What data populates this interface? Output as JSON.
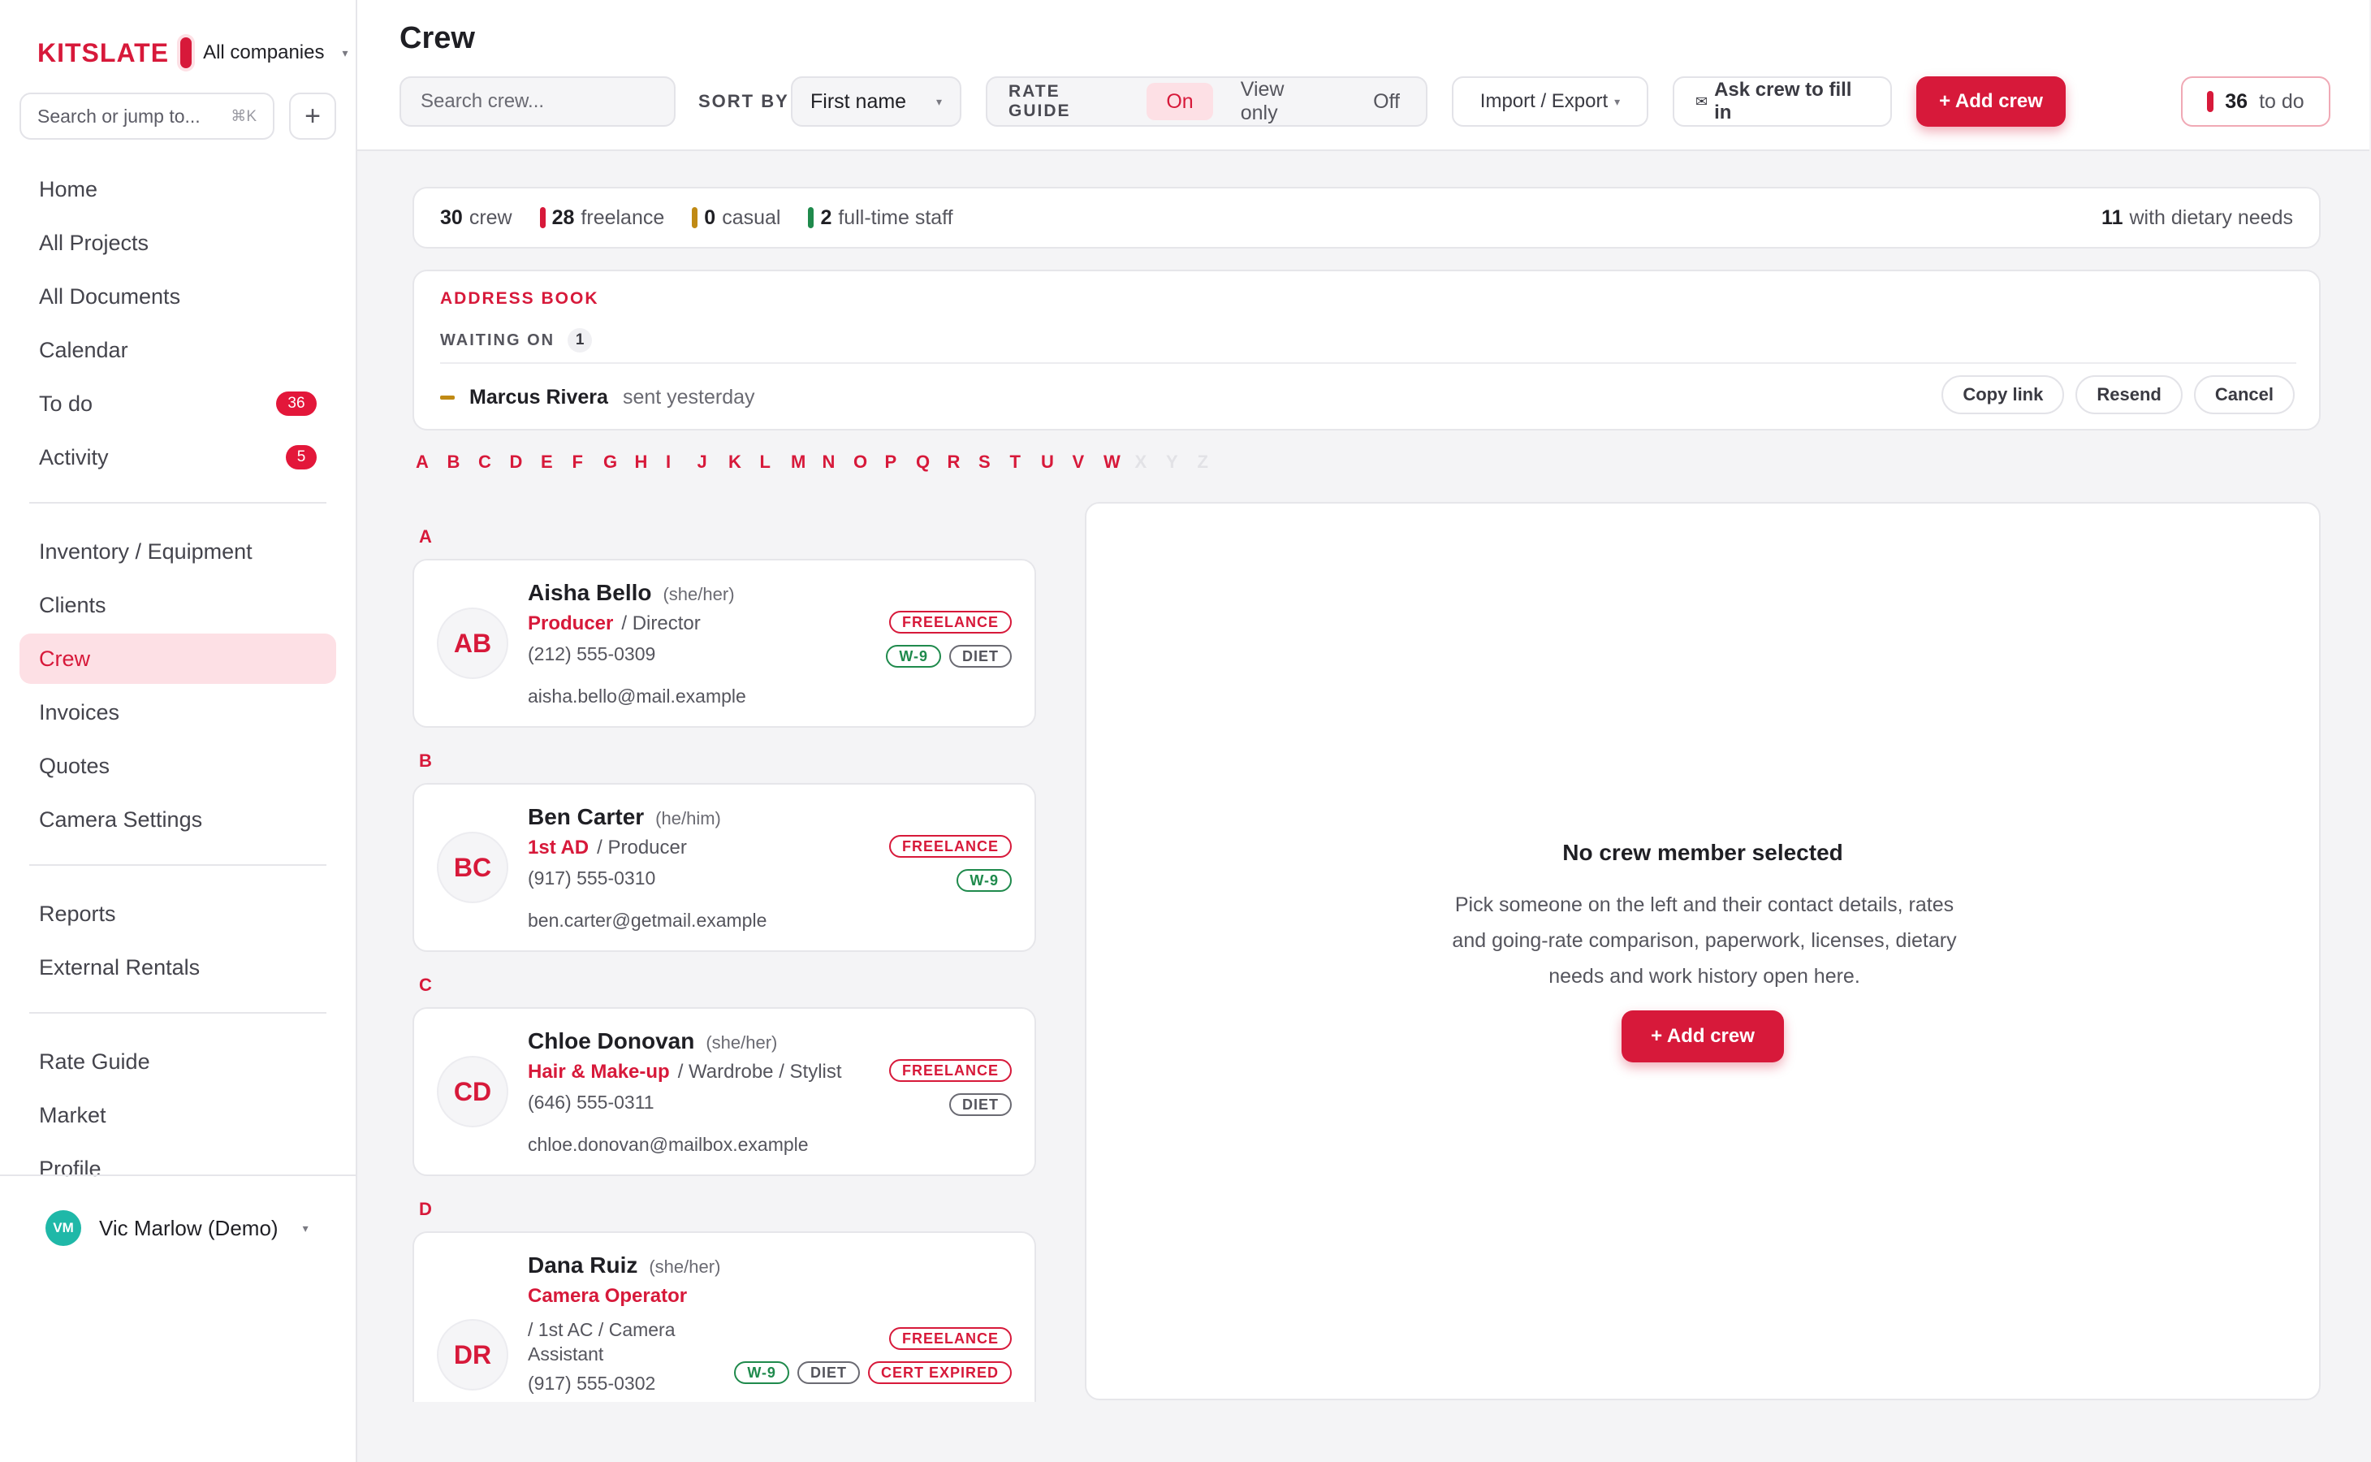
{
  "brand": {
    "name": "KITSLATE",
    "company": "All companies"
  },
  "sidebar": {
    "search_placeholder": "Search or jump to...",
    "search_kbd": "⌘K",
    "items_group1": [
      {
        "label": "Home"
      },
      {
        "label": "All Projects"
      },
      {
        "label": "All Documents"
      },
      {
        "label": "Calendar"
      },
      {
        "label": "To do",
        "badge": "36"
      },
      {
        "label": "Activity",
        "badge": "5"
      }
    ],
    "items_group2": [
      {
        "label": "Inventory / Equipment"
      },
      {
        "label": "Clients"
      },
      {
        "label": "Crew",
        "active": true
      },
      {
        "label": "Invoices"
      },
      {
        "label": "Quotes"
      },
      {
        "label": "Camera Settings"
      }
    ],
    "items_group3": [
      {
        "label": "Reports"
      },
      {
        "label": "External Rentals"
      }
    ],
    "items_group4": [
      {
        "label": "Rate Guide"
      },
      {
        "label": "Market"
      },
      {
        "label": "Profile"
      }
    ],
    "user": {
      "initials": "VM",
      "name": "Vic Marlow (Demo)"
    }
  },
  "header": {
    "title": "Crew",
    "search_placeholder": "Search crew...",
    "sort_label": "SORT BY",
    "sort_value": "First name",
    "rate_guide_label": "RATE GUIDE",
    "rate_options": [
      "On",
      "View only",
      "Off"
    ],
    "rate_selected": "On",
    "import_export": "Import / Export",
    "ask_crew": "Ask crew to fill in",
    "add_crew": "+ Add crew",
    "todo_count": "36",
    "todo_label": "to do"
  },
  "stats": {
    "crew": "30",
    "crew_label": "crew",
    "freelance": "28",
    "freelance_label": "freelance",
    "casual": "0",
    "casual_label": "casual",
    "staff": "2",
    "staff_label": "full-time staff",
    "dietary": "11",
    "dietary_label": "with dietary needs",
    "colors": {
      "freelance": "#d7193a",
      "casual": "#c08a14",
      "staff": "#1f8a4c"
    }
  },
  "address_book": {
    "title": "ADDRESS BOOK",
    "waiting_label": "WAITING ON",
    "waiting_count": "1",
    "pending": {
      "name": "Marcus Rivera",
      "status": "sent yesterday"
    },
    "actions": [
      "Copy link",
      "Resend",
      "Cancel"
    ]
  },
  "alphabet": {
    "active": [
      "A",
      "B",
      "C",
      "D",
      "E",
      "F",
      "G",
      "H",
      "I",
      "J",
      "K",
      "L",
      "M",
      "N",
      "O",
      "P",
      "Q",
      "R",
      "S",
      "T",
      "U",
      "V",
      "W"
    ],
    "inactive": [
      "X",
      "Y",
      "Z"
    ]
  },
  "crew": [
    {
      "letter": "A",
      "initials": "AB",
      "name": "Aisha Bello",
      "pronouns": "(she/her)",
      "role": "Producer",
      "role_extra": "/ Director",
      "phone": "(212) 555-0309",
      "email": "aisha.bello@mail.example",
      "tags": [
        "FREELANCE"
      ],
      "tags2": [
        "W-9",
        "DIET"
      ]
    },
    {
      "letter": "B",
      "initials": "BC",
      "name": "Ben Carter",
      "pronouns": "(he/him)",
      "role": "1st AD",
      "role_extra": "/ Producer",
      "phone": "(917) 555-0310",
      "email": "ben.carter@getmail.example",
      "tags": [
        "FREELANCE"
      ],
      "tags2": [
        "W-9"
      ]
    },
    {
      "letter": "C",
      "initials": "CD",
      "name": "Chloe Donovan",
      "pronouns": "(she/her)",
      "role": "Hair & Make-up",
      "role_extra": "/ Wardrobe / Stylist",
      "phone": "(646) 555-0311",
      "email": "chloe.donovan@mailbox.example",
      "tags": [
        "FREELANCE"
      ],
      "tags2": [
        "DIET"
      ]
    },
    {
      "letter": "D",
      "initials": "DR",
      "name": "Dana Ruiz",
      "pronouns": "(she/her)",
      "role": "Camera Operator",
      "role_extra_1": "/ 1st AC / Camera",
      "role_extra_2": "Assistant",
      "phone": "(917) 555-0302",
      "tags": [
        "FREELANCE"
      ],
      "tags2": [
        "W-9",
        "DIET",
        "CERT EXPIRED"
      ]
    }
  ],
  "detail": {
    "empty_title": "No crew member selected",
    "empty_body": "Pick someone on the left and their contact details, rates and going-rate comparison, paperwork, licenses, dietary needs and work history open here.",
    "add_crew": "+ Add crew"
  },
  "colors": {
    "accent": "#d7193a",
    "accent_soft": "#fde0e5",
    "success": "#1f8a4c",
    "warning": "#c08a14"
  }
}
